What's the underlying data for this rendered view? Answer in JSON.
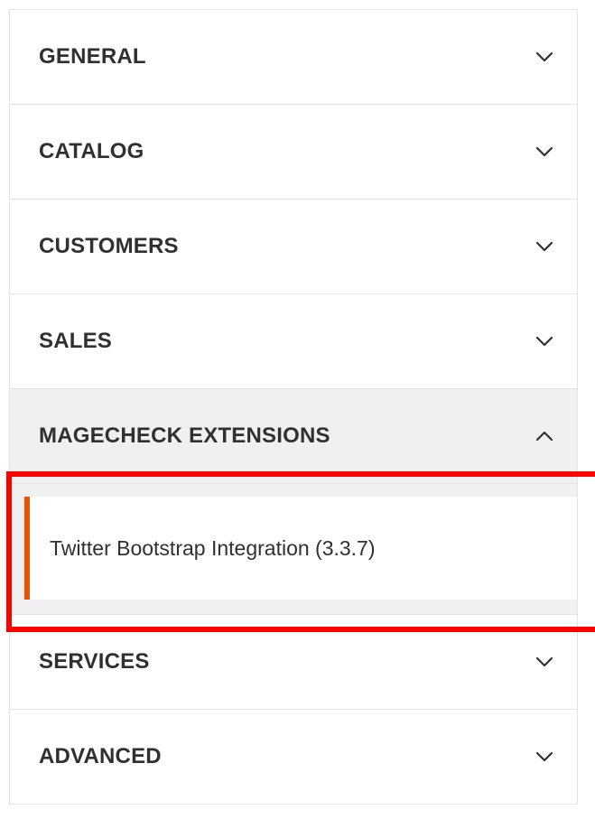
{
  "sections": [
    {
      "title": "GENERAL",
      "expanded": false,
      "icon": "chevron-down-icon"
    },
    {
      "title": "CATALOG",
      "expanded": false,
      "icon": "chevron-down-icon"
    },
    {
      "title": "CUSTOMERS",
      "expanded": false,
      "icon": "chevron-down-icon"
    },
    {
      "title": "SALES",
      "expanded": false,
      "icon": "chevron-down-icon"
    },
    {
      "title": "MAGECHECK EXTENSIONS",
      "expanded": true,
      "icon": "chevron-up-icon",
      "items": [
        {
          "label": "Twitter Bootstrap Integration (3.3.7)",
          "active": true
        }
      ]
    },
    {
      "title": "SERVICES",
      "expanded": false,
      "icon": "chevron-down-icon"
    },
    {
      "title": "ADVANCED",
      "expanded": false,
      "icon": "chevron-down-icon"
    }
  ],
  "colors": {
    "accent": "#eb5202",
    "highlight": "#ff0000",
    "text": "#303030",
    "expanded_bg": "#f0f0f0",
    "border": "#e3e3e3"
  }
}
